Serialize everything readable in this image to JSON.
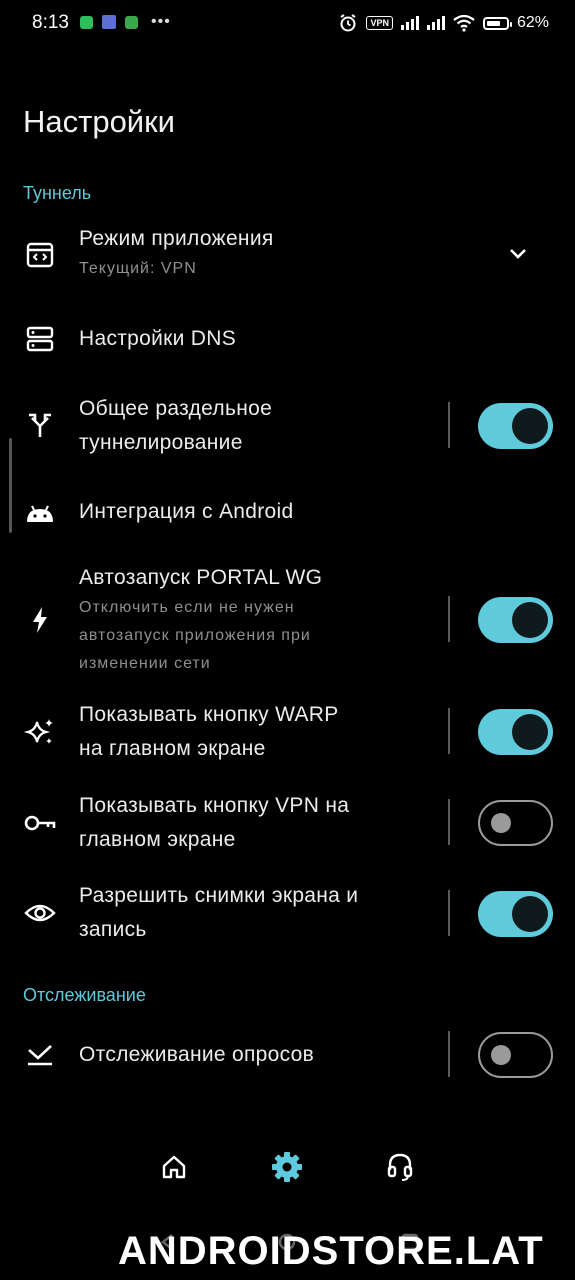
{
  "status_bar": {
    "time": "8:13",
    "vpn_label": "VPN",
    "battery": "62%",
    "dots": "•••"
  },
  "header": {
    "title": "Настройки"
  },
  "sections": {
    "tunnel": "Туннель",
    "tracking": "Отслеживание"
  },
  "rows": {
    "app_mode": {
      "title": "Режим приложения",
      "subtitle": "Текущий: VPN",
      "icon": "code-window-icon"
    },
    "dns": {
      "title": "Настройки DNS",
      "icon": "dns-server-icon"
    },
    "split_tunnel": {
      "title_line1": "Общее раздельное",
      "title_line2": "туннелирование",
      "icon": "call-split-icon",
      "enabled": true
    },
    "android_integration": {
      "title": "Интеграция с Android",
      "icon": "android-icon"
    },
    "autostart": {
      "title": "Автозапуск PORTAL WG",
      "subtitle_line1": "Отключить если не нужен",
      "subtitle_line2": "автозапуск приложения при",
      "subtitle_line3": "изменении сети",
      "icon": "bolt-icon",
      "enabled": true
    },
    "warp_button": {
      "title_line1": "Показывать кнопку WARP",
      "title_line2": "на главном экране",
      "icon": "sparkles-icon",
      "enabled": true
    },
    "vpn_button": {
      "title_line1": "Показывать кнопку VPN на",
      "title_line2": "главном экране",
      "icon": "key-icon",
      "enabled": false
    },
    "screenshots": {
      "title_line1": "Разрешить снимки экрана и",
      "title_line2": "запись",
      "icon": "eye-icon",
      "enabled": true
    },
    "ping_tracking": {
      "title": "Отслеживание опросов",
      "icon": "download-done-icon",
      "enabled": false
    }
  },
  "bottom_nav": {
    "items": [
      {
        "name": "home",
        "icon": "home-icon",
        "active": false
      },
      {
        "name": "settings",
        "icon": "gear-icon",
        "active": true
      },
      {
        "name": "support",
        "icon": "headset-icon",
        "active": false
      }
    ]
  },
  "watermark": "ANDROIDSTORE.LAT",
  "colors": {
    "accent": "#5fcadb",
    "background": "#000000",
    "text": "#ececec",
    "subtext": "#8f8f8f"
  }
}
